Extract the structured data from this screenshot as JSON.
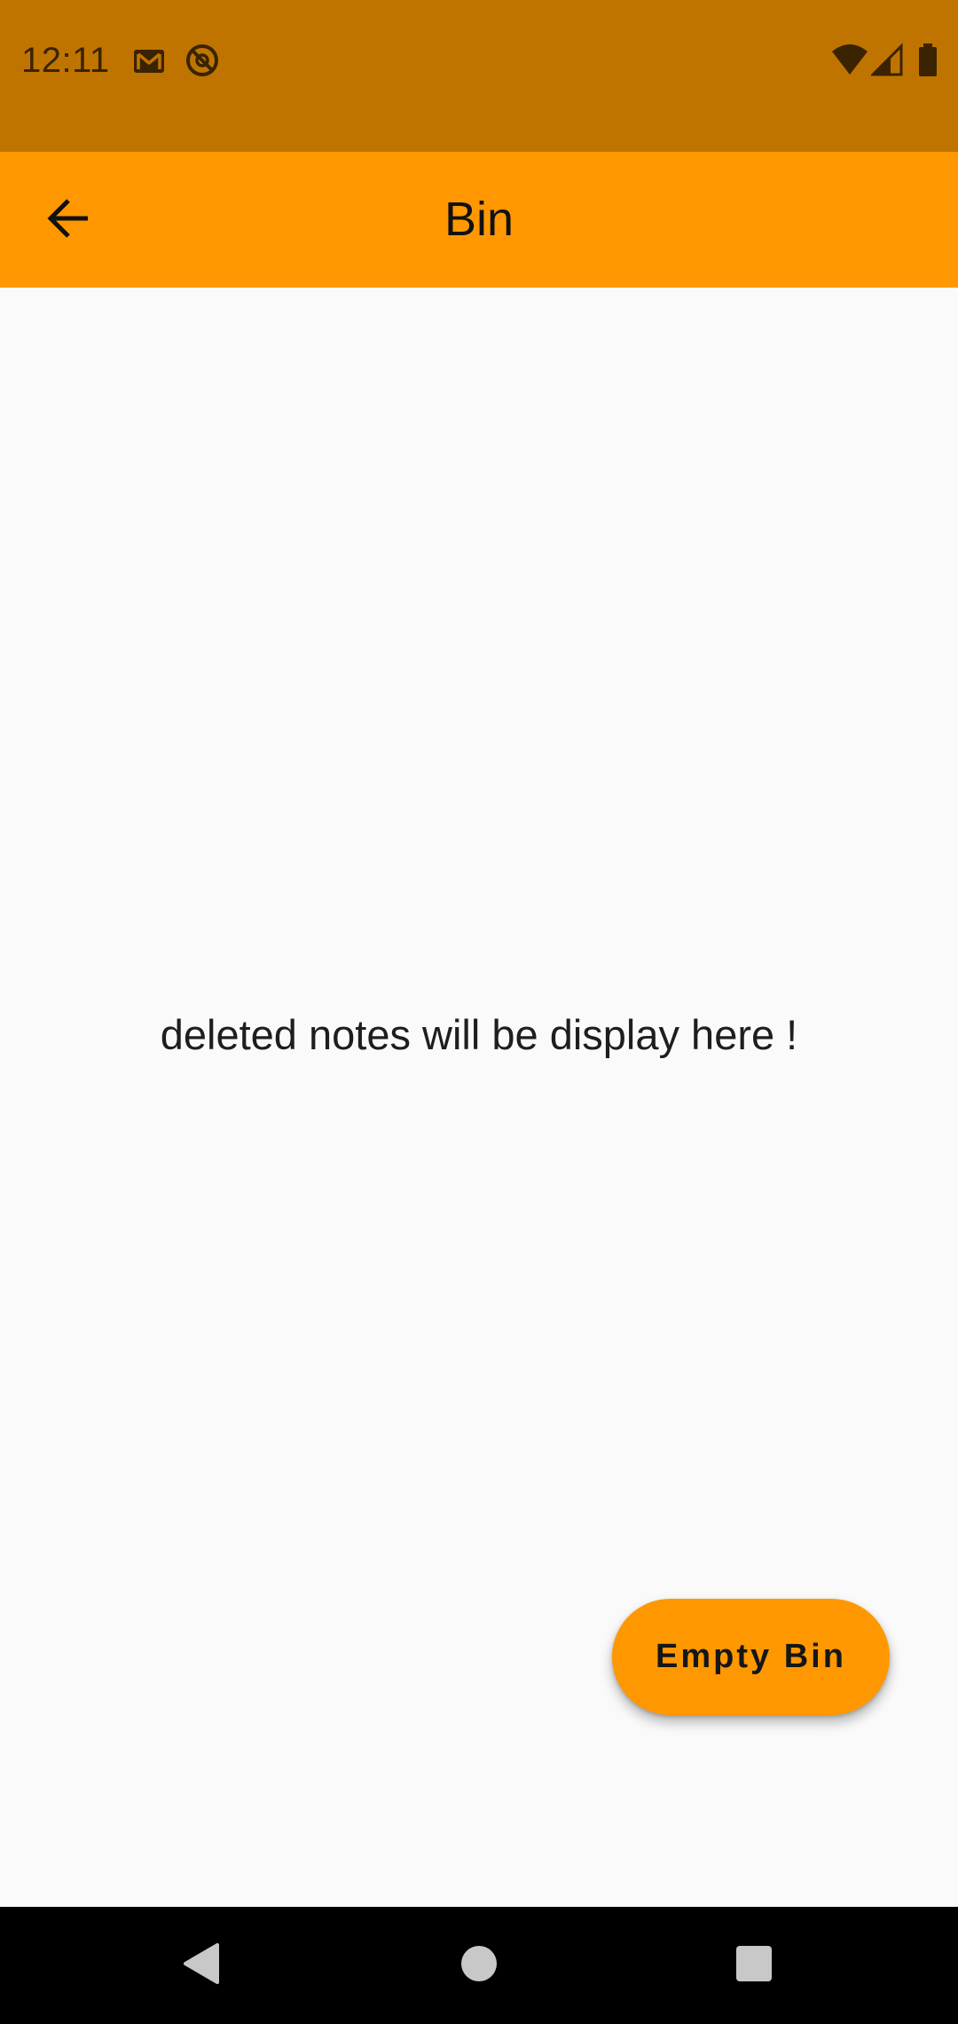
{
  "status_bar": {
    "time": "12:11",
    "left_icons": [
      "gmail-icon",
      "do-not-disturb-icon"
    ],
    "right_icons": [
      "wifi-icon",
      "signal-icon",
      "battery-icon"
    ]
  },
  "app_bar": {
    "title": "Bin",
    "back_icon": "arrow-back-icon"
  },
  "content": {
    "empty_message": "deleted notes will be display here !"
  },
  "fab": {
    "label": "Empty Bin"
  },
  "nav_bar": {
    "buttons": [
      "back-triangle-icon",
      "home-circle-icon",
      "recents-square-icon"
    ]
  },
  "colors": {
    "status_bar": "#c07400",
    "app_bar": "#ff9800",
    "background": "#fafafa",
    "fab": "#ff9800",
    "nav_bar": "#000000"
  }
}
